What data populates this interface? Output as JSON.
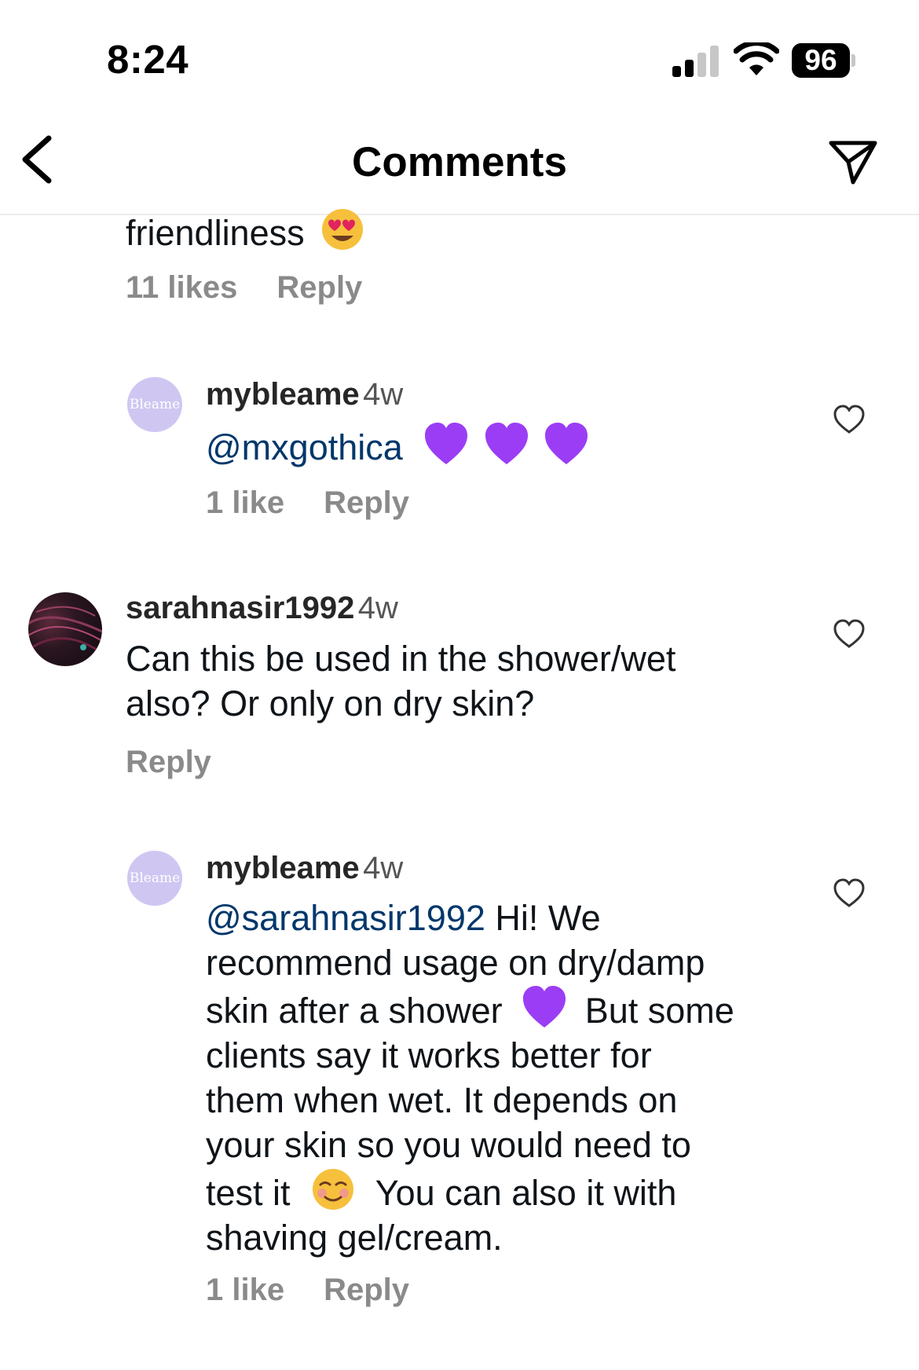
{
  "status_bar": {
    "time": "8:24",
    "battery": "96"
  },
  "header": {
    "title": "Comments"
  },
  "comments": [
    {
      "text_fragment": "friendliness",
      "likes": "11 likes",
      "reply": "Reply"
    },
    {
      "avatar_text": "Bleame",
      "username": "mybleame",
      "time": "4w",
      "mention": "@mxgothica",
      "likes": "1 like",
      "reply": "Reply"
    },
    {
      "username": "sarahnasir1992",
      "time": "4w",
      "text_lines": [
        "Can this be used in the shower/wet",
        "also? Or only on dry skin?"
      ],
      "reply": "Reply"
    },
    {
      "avatar_text": "Bleame",
      "username": "mybleame",
      "time": "4w",
      "mention": "@sarahnasir1992",
      "line1_rest": "Hi! We",
      "line2": "recommend usage on dry/damp",
      "line3_a": "skin after a shower",
      "line3_b": "But some",
      "line4": "clients say it works better for",
      "line5": "them when wet. It depends on",
      "line6": "your skin so you would need to",
      "line7_a": "test it",
      "line7_b": "You can also it with",
      "line8": "shaving gel/cream.",
      "likes": "1 like",
      "reply": "Reply"
    }
  ],
  "icons": {
    "back": "chevron-left-icon",
    "share": "send-icon",
    "like": "heart-outline-icon",
    "emoji_heart_eyes": "heart-eyes-emoji",
    "emoji_purple_heart": "purple-heart-emoji",
    "emoji_smiling": "smiling-face-emoji"
  },
  "colors": {
    "mention": "#00376b",
    "purple_heart": "#9b3df5",
    "brand_avatar": "#cfc7f2"
  }
}
